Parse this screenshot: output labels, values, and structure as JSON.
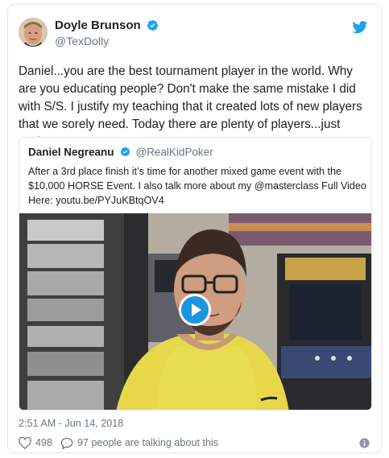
{
  "author": {
    "name": "Doyle Brunson",
    "handle": "@TexDolly",
    "verified": true
  },
  "tweet_text": "Daniel...you are the best tournament player in the world. Why are you educating people? Don't make the same mistake I did with S/S. I justify my teaching that it created lots of new players that we sorely need. Today there are plenty of players...just saying.",
  "quoted": {
    "name": "Daniel Negreanu",
    "handle": "@RealKidPoker",
    "verified": true,
    "text": "After a 3rd place finish it’s time for another mixed game event with the $10,000 HORSE Event. I also talk more about my @masterclass Full Video Here: youtu.be/PYJuKBtqOV4"
  },
  "timestamp": "2:51 AM - Jun 14, 2018",
  "likes": "498",
  "talking": "97 people are talking about this",
  "colors": {
    "brand_blue": "#1da1f2",
    "play_blue": "#1b95e0",
    "muted_text": "#697882",
    "border": "#e1e8ed"
  },
  "icons": {
    "verified": "verified-badge-icon",
    "brand": "twitter-bird-icon",
    "like": "heart-icon",
    "reply": "speech-bubble-icon",
    "info": "info-icon",
    "play": "play-icon"
  }
}
